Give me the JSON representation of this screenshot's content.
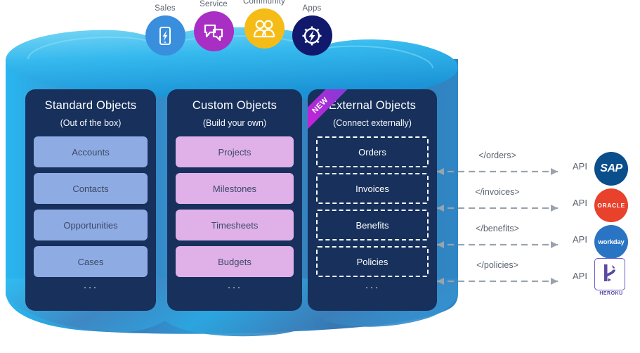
{
  "apps": [
    {
      "label": "Sales",
      "icon": "mobile-lightning-icon",
      "color": "#3a8ede"
    },
    {
      "label": "Service",
      "icon": "speech-bubbles-icon",
      "color": "#a82ec4"
    },
    {
      "label": "Community",
      "icon": "people-group-icon",
      "color": "#f5bc18"
    },
    {
      "label": "Apps",
      "icon": "gear-lightning-icon",
      "color": "#10196b"
    }
  ],
  "panels": [
    {
      "id": "standard",
      "title": "Standard Objects",
      "subtitle": "(Out of the box)",
      "badge": null,
      "item_style": "std",
      "items": [
        "Accounts",
        "Contacts",
        "Opportunities",
        "Cases"
      ],
      "more": "···"
    },
    {
      "id": "custom",
      "title": "Custom Objects",
      "subtitle": "(Build your own)",
      "badge": null,
      "item_style": "cus",
      "items": [
        "Projects",
        "Milestones",
        "Timesheets",
        "Budgets"
      ],
      "more": "···"
    },
    {
      "id": "external",
      "title": "External Objects",
      "subtitle": "(Connect externally)",
      "badge": "NEW",
      "item_style": "ext",
      "items": [
        "Orders",
        "Invoices",
        "Benefits",
        "Policies"
      ],
      "more": "···"
    }
  ],
  "connections": [
    {
      "label": "</orders>",
      "api": "API",
      "vendor": "SAP",
      "vendor_type": "circle",
      "color": "#0a4e8c"
    },
    {
      "label": "</invoices>",
      "api": "API",
      "vendor": "ORACLE",
      "vendor_type": "circle",
      "color": "#e8412c"
    },
    {
      "label": "</benefits>",
      "api": "API",
      "vendor": "workday",
      "vendor_type": "circle",
      "color": "#2a74c4"
    },
    {
      "label": "</policies>",
      "api": "API",
      "vendor": "HEROKU",
      "vendor_type": "square",
      "color": "#6a5acd"
    }
  ],
  "colors": {
    "cloud_light": "#29b6ef",
    "cloud_dark": "#2f79b8",
    "panel_bg": "#17305c",
    "standard_item": "#8fabe3",
    "custom_item": "#e0b0e8",
    "ribbon_start": "#d81bd8",
    "ribbon_end": "#7c3fd6",
    "connector": "#9aa3ad",
    "text_gray": "#5c6370"
  }
}
